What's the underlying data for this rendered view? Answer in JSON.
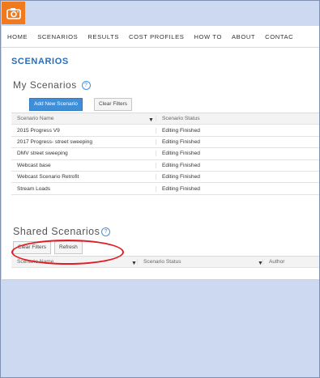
{
  "nav": {
    "items": [
      "HOME",
      "SCENARIOS",
      "RESULTS",
      "COST PROFILES",
      "HOW TO",
      "ABOUT",
      "CONTAC"
    ]
  },
  "page_title": "SCENARIOS",
  "my_scenarios": {
    "title": "My Scenarios",
    "add_button": "Add New Scenario",
    "clear_button": "Clear Filters",
    "columns": [
      "Scenario Name",
      "Scenario Status"
    ],
    "rows": [
      {
        "name": "2015 Progress V9",
        "status": "Editing Finished"
      },
      {
        "name": "2017 Progress- street sweeping",
        "status": "Editing Finished"
      },
      {
        "name": "DMV street sweeping",
        "status": "Editing Finished"
      },
      {
        "name": "Webcast base",
        "status": "Editing Finished"
      },
      {
        "name": "Webcast Scenario Retrofit",
        "status": "Editing Finished"
      },
      {
        "name": "Stream Loads",
        "status": "Editing Finished"
      }
    ]
  },
  "shared_scenarios": {
    "title": "Shared Scenarios",
    "clear_button": "Clear Filters",
    "refresh_button": "Refresh",
    "columns": [
      "Scenario Name",
      "Scenario Status",
      "Author"
    ]
  },
  "colors": {
    "camera_button": "#f07a1f",
    "background": "#ccd9f1",
    "primary_button": "#3e8ed8",
    "title_blue": "#2a6db7",
    "highlight_circle": "#e11b22"
  },
  "icons": [
    "camera-icon",
    "help-icon",
    "filter-icon"
  ]
}
